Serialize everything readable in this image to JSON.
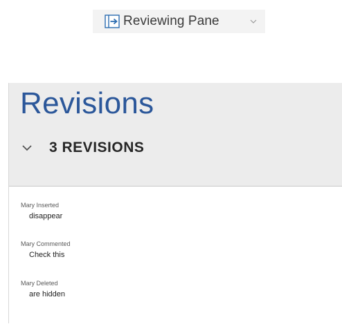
{
  "ribbon": {
    "button_label": "Reviewing Pane",
    "icon": "reviewing-pane-icon",
    "dropdown_icon": "chevron-down-icon"
  },
  "pane": {
    "title": "Revisions",
    "summary": "3 REVISIONS",
    "collapse_icon": "chevron-down-icon",
    "revisions": [
      {
        "author_action": "Mary Inserted",
        "content": "disappear"
      },
      {
        "author_action": "Mary Commented",
        "content": "Check this"
      },
      {
        "author_action": "Mary Deleted",
        "content": "are hidden"
      }
    ]
  },
  "colors": {
    "accent": "#2b579a",
    "pane_background": "#ececec",
    "button_background": "#f3f3f3"
  }
}
